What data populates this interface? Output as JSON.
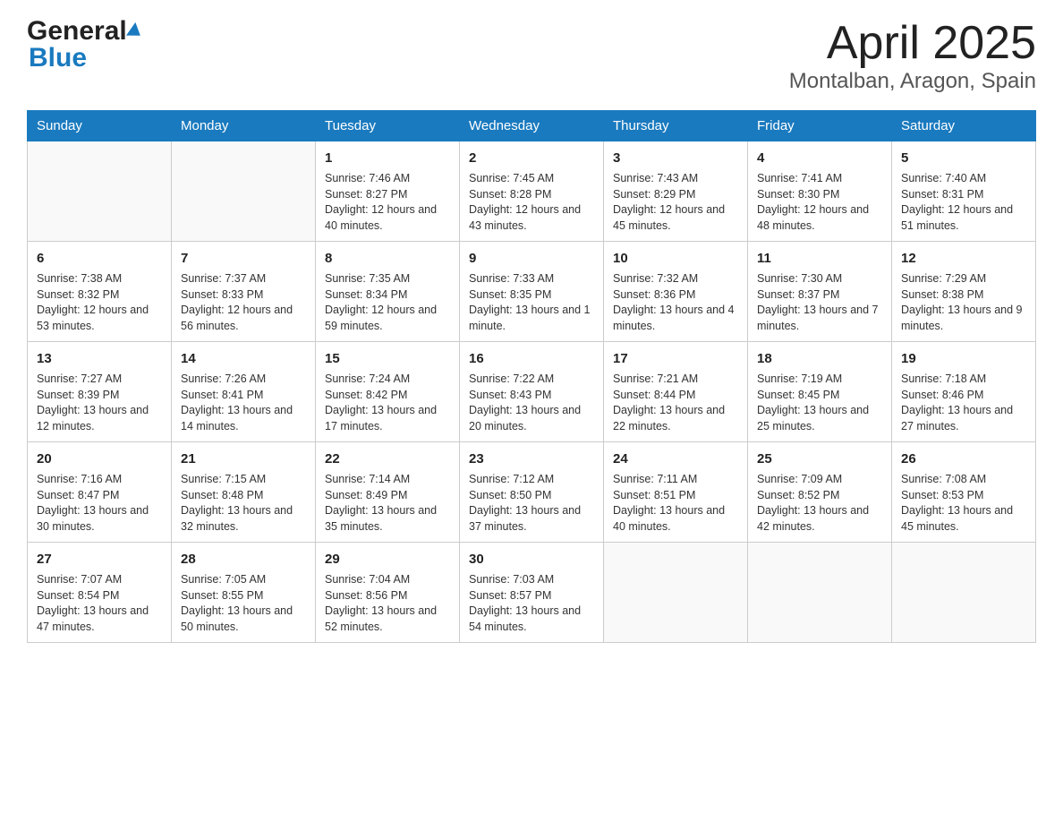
{
  "logo": {
    "general": "General",
    "blue": "Blue"
  },
  "title": "April 2025",
  "subtitle": "Montalban, Aragon, Spain",
  "weekdays": [
    "Sunday",
    "Monday",
    "Tuesday",
    "Wednesday",
    "Thursday",
    "Friday",
    "Saturday"
  ],
  "weeks": [
    [
      {
        "day": "",
        "sunrise": "",
        "sunset": "",
        "daylight": ""
      },
      {
        "day": "",
        "sunrise": "",
        "sunset": "",
        "daylight": ""
      },
      {
        "day": "1",
        "sunrise": "Sunrise: 7:46 AM",
        "sunset": "Sunset: 8:27 PM",
        "daylight": "Daylight: 12 hours and 40 minutes."
      },
      {
        "day": "2",
        "sunrise": "Sunrise: 7:45 AM",
        "sunset": "Sunset: 8:28 PM",
        "daylight": "Daylight: 12 hours and 43 minutes."
      },
      {
        "day": "3",
        "sunrise": "Sunrise: 7:43 AM",
        "sunset": "Sunset: 8:29 PM",
        "daylight": "Daylight: 12 hours and 45 minutes."
      },
      {
        "day": "4",
        "sunrise": "Sunrise: 7:41 AM",
        "sunset": "Sunset: 8:30 PM",
        "daylight": "Daylight: 12 hours and 48 minutes."
      },
      {
        "day": "5",
        "sunrise": "Sunrise: 7:40 AM",
        "sunset": "Sunset: 8:31 PM",
        "daylight": "Daylight: 12 hours and 51 minutes."
      }
    ],
    [
      {
        "day": "6",
        "sunrise": "Sunrise: 7:38 AM",
        "sunset": "Sunset: 8:32 PM",
        "daylight": "Daylight: 12 hours and 53 minutes."
      },
      {
        "day": "7",
        "sunrise": "Sunrise: 7:37 AM",
        "sunset": "Sunset: 8:33 PM",
        "daylight": "Daylight: 12 hours and 56 minutes."
      },
      {
        "day": "8",
        "sunrise": "Sunrise: 7:35 AM",
        "sunset": "Sunset: 8:34 PM",
        "daylight": "Daylight: 12 hours and 59 minutes."
      },
      {
        "day": "9",
        "sunrise": "Sunrise: 7:33 AM",
        "sunset": "Sunset: 8:35 PM",
        "daylight": "Daylight: 13 hours and 1 minute."
      },
      {
        "day": "10",
        "sunrise": "Sunrise: 7:32 AM",
        "sunset": "Sunset: 8:36 PM",
        "daylight": "Daylight: 13 hours and 4 minutes."
      },
      {
        "day": "11",
        "sunrise": "Sunrise: 7:30 AM",
        "sunset": "Sunset: 8:37 PM",
        "daylight": "Daylight: 13 hours and 7 minutes."
      },
      {
        "day": "12",
        "sunrise": "Sunrise: 7:29 AM",
        "sunset": "Sunset: 8:38 PM",
        "daylight": "Daylight: 13 hours and 9 minutes."
      }
    ],
    [
      {
        "day": "13",
        "sunrise": "Sunrise: 7:27 AM",
        "sunset": "Sunset: 8:39 PM",
        "daylight": "Daylight: 13 hours and 12 minutes."
      },
      {
        "day": "14",
        "sunrise": "Sunrise: 7:26 AM",
        "sunset": "Sunset: 8:41 PM",
        "daylight": "Daylight: 13 hours and 14 minutes."
      },
      {
        "day": "15",
        "sunrise": "Sunrise: 7:24 AM",
        "sunset": "Sunset: 8:42 PM",
        "daylight": "Daylight: 13 hours and 17 minutes."
      },
      {
        "day": "16",
        "sunrise": "Sunrise: 7:22 AM",
        "sunset": "Sunset: 8:43 PM",
        "daylight": "Daylight: 13 hours and 20 minutes."
      },
      {
        "day": "17",
        "sunrise": "Sunrise: 7:21 AM",
        "sunset": "Sunset: 8:44 PM",
        "daylight": "Daylight: 13 hours and 22 minutes."
      },
      {
        "day": "18",
        "sunrise": "Sunrise: 7:19 AM",
        "sunset": "Sunset: 8:45 PM",
        "daylight": "Daylight: 13 hours and 25 minutes."
      },
      {
        "day": "19",
        "sunrise": "Sunrise: 7:18 AM",
        "sunset": "Sunset: 8:46 PM",
        "daylight": "Daylight: 13 hours and 27 minutes."
      }
    ],
    [
      {
        "day": "20",
        "sunrise": "Sunrise: 7:16 AM",
        "sunset": "Sunset: 8:47 PM",
        "daylight": "Daylight: 13 hours and 30 minutes."
      },
      {
        "day": "21",
        "sunrise": "Sunrise: 7:15 AM",
        "sunset": "Sunset: 8:48 PM",
        "daylight": "Daylight: 13 hours and 32 minutes."
      },
      {
        "day": "22",
        "sunrise": "Sunrise: 7:14 AM",
        "sunset": "Sunset: 8:49 PM",
        "daylight": "Daylight: 13 hours and 35 minutes."
      },
      {
        "day": "23",
        "sunrise": "Sunrise: 7:12 AM",
        "sunset": "Sunset: 8:50 PM",
        "daylight": "Daylight: 13 hours and 37 minutes."
      },
      {
        "day": "24",
        "sunrise": "Sunrise: 7:11 AM",
        "sunset": "Sunset: 8:51 PM",
        "daylight": "Daylight: 13 hours and 40 minutes."
      },
      {
        "day": "25",
        "sunrise": "Sunrise: 7:09 AM",
        "sunset": "Sunset: 8:52 PM",
        "daylight": "Daylight: 13 hours and 42 minutes."
      },
      {
        "day": "26",
        "sunrise": "Sunrise: 7:08 AM",
        "sunset": "Sunset: 8:53 PM",
        "daylight": "Daylight: 13 hours and 45 minutes."
      }
    ],
    [
      {
        "day": "27",
        "sunrise": "Sunrise: 7:07 AM",
        "sunset": "Sunset: 8:54 PM",
        "daylight": "Daylight: 13 hours and 47 minutes."
      },
      {
        "day": "28",
        "sunrise": "Sunrise: 7:05 AM",
        "sunset": "Sunset: 8:55 PM",
        "daylight": "Daylight: 13 hours and 50 minutes."
      },
      {
        "day": "29",
        "sunrise": "Sunrise: 7:04 AM",
        "sunset": "Sunset: 8:56 PM",
        "daylight": "Daylight: 13 hours and 52 minutes."
      },
      {
        "day": "30",
        "sunrise": "Sunrise: 7:03 AM",
        "sunset": "Sunset: 8:57 PM",
        "daylight": "Daylight: 13 hours and 54 minutes."
      },
      {
        "day": "",
        "sunrise": "",
        "sunset": "",
        "daylight": ""
      },
      {
        "day": "",
        "sunrise": "",
        "sunset": "",
        "daylight": ""
      },
      {
        "day": "",
        "sunrise": "",
        "sunset": "",
        "daylight": ""
      }
    ]
  ],
  "colors": {
    "header_bg": "#1a7abf",
    "header_text": "#ffffff",
    "border": "#cccccc",
    "body_bg": "#ffffff",
    "empty_bg": "#f9f9f9"
  }
}
